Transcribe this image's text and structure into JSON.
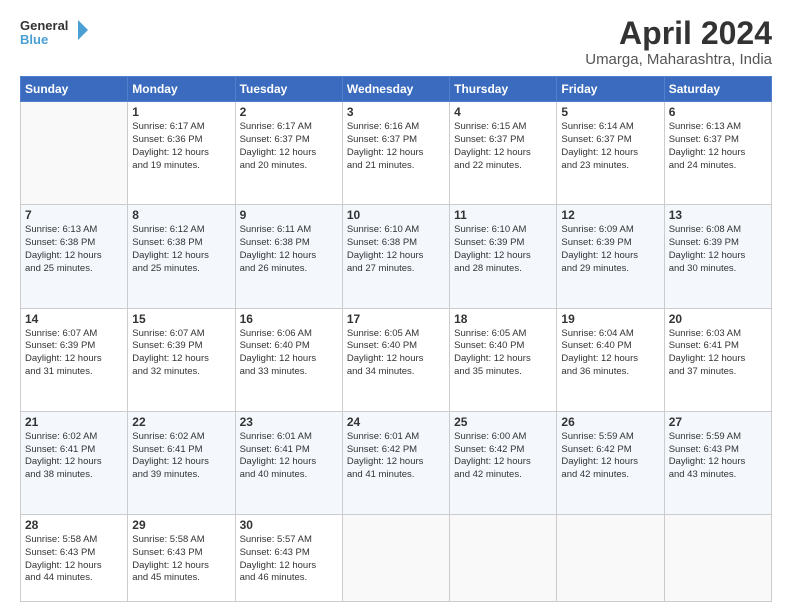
{
  "header": {
    "logo": {
      "line1": "General",
      "line2": "Blue"
    },
    "title": "April 2024",
    "subtitle": "Umarga, Maharashtra, India"
  },
  "weekdays": [
    "Sunday",
    "Monday",
    "Tuesday",
    "Wednesday",
    "Thursday",
    "Friday",
    "Saturday"
  ],
  "weeks": [
    [
      {
        "day": "",
        "info": ""
      },
      {
        "day": "1",
        "info": "Sunrise: 6:17 AM\nSunset: 6:36 PM\nDaylight: 12 hours\nand 19 minutes."
      },
      {
        "day": "2",
        "info": "Sunrise: 6:17 AM\nSunset: 6:37 PM\nDaylight: 12 hours\nand 20 minutes."
      },
      {
        "day": "3",
        "info": "Sunrise: 6:16 AM\nSunset: 6:37 PM\nDaylight: 12 hours\nand 21 minutes."
      },
      {
        "day": "4",
        "info": "Sunrise: 6:15 AM\nSunset: 6:37 PM\nDaylight: 12 hours\nand 22 minutes."
      },
      {
        "day": "5",
        "info": "Sunrise: 6:14 AM\nSunset: 6:37 PM\nDaylight: 12 hours\nand 23 minutes."
      },
      {
        "day": "6",
        "info": "Sunrise: 6:13 AM\nSunset: 6:37 PM\nDaylight: 12 hours\nand 24 minutes."
      }
    ],
    [
      {
        "day": "7",
        "info": "Sunrise: 6:13 AM\nSunset: 6:38 PM\nDaylight: 12 hours\nand 25 minutes."
      },
      {
        "day": "8",
        "info": "Sunrise: 6:12 AM\nSunset: 6:38 PM\nDaylight: 12 hours\nand 25 minutes."
      },
      {
        "day": "9",
        "info": "Sunrise: 6:11 AM\nSunset: 6:38 PM\nDaylight: 12 hours\nand 26 minutes."
      },
      {
        "day": "10",
        "info": "Sunrise: 6:10 AM\nSunset: 6:38 PM\nDaylight: 12 hours\nand 27 minutes."
      },
      {
        "day": "11",
        "info": "Sunrise: 6:10 AM\nSunset: 6:39 PM\nDaylight: 12 hours\nand 28 minutes."
      },
      {
        "day": "12",
        "info": "Sunrise: 6:09 AM\nSunset: 6:39 PM\nDaylight: 12 hours\nand 29 minutes."
      },
      {
        "day": "13",
        "info": "Sunrise: 6:08 AM\nSunset: 6:39 PM\nDaylight: 12 hours\nand 30 minutes."
      }
    ],
    [
      {
        "day": "14",
        "info": "Sunrise: 6:07 AM\nSunset: 6:39 PM\nDaylight: 12 hours\nand 31 minutes."
      },
      {
        "day": "15",
        "info": "Sunrise: 6:07 AM\nSunset: 6:39 PM\nDaylight: 12 hours\nand 32 minutes."
      },
      {
        "day": "16",
        "info": "Sunrise: 6:06 AM\nSunset: 6:40 PM\nDaylight: 12 hours\nand 33 minutes."
      },
      {
        "day": "17",
        "info": "Sunrise: 6:05 AM\nSunset: 6:40 PM\nDaylight: 12 hours\nand 34 minutes."
      },
      {
        "day": "18",
        "info": "Sunrise: 6:05 AM\nSunset: 6:40 PM\nDaylight: 12 hours\nand 35 minutes."
      },
      {
        "day": "19",
        "info": "Sunrise: 6:04 AM\nSunset: 6:40 PM\nDaylight: 12 hours\nand 36 minutes."
      },
      {
        "day": "20",
        "info": "Sunrise: 6:03 AM\nSunset: 6:41 PM\nDaylight: 12 hours\nand 37 minutes."
      }
    ],
    [
      {
        "day": "21",
        "info": "Sunrise: 6:02 AM\nSunset: 6:41 PM\nDaylight: 12 hours\nand 38 minutes."
      },
      {
        "day": "22",
        "info": "Sunrise: 6:02 AM\nSunset: 6:41 PM\nDaylight: 12 hours\nand 39 minutes."
      },
      {
        "day": "23",
        "info": "Sunrise: 6:01 AM\nSunset: 6:41 PM\nDaylight: 12 hours\nand 40 minutes."
      },
      {
        "day": "24",
        "info": "Sunrise: 6:01 AM\nSunset: 6:42 PM\nDaylight: 12 hours\nand 41 minutes."
      },
      {
        "day": "25",
        "info": "Sunrise: 6:00 AM\nSunset: 6:42 PM\nDaylight: 12 hours\nand 42 minutes."
      },
      {
        "day": "26",
        "info": "Sunrise: 5:59 AM\nSunset: 6:42 PM\nDaylight: 12 hours\nand 42 minutes."
      },
      {
        "day": "27",
        "info": "Sunrise: 5:59 AM\nSunset: 6:43 PM\nDaylight: 12 hours\nand 43 minutes."
      }
    ],
    [
      {
        "day": "28",
        "info": "Sunrise: 5:58 AM\nSunset: 6:43 PM\nDaylight: 12 hours\nand 44 minutes."
      },
      {
        "day": "29",
        "info": "Sunrise: 5:58 AM\nSunset: 6:43 PM\nDaylight: 12 hours\nand 45 minutes."
      },
      {
        "day": "30",
        "info": "Sunrise: 5:57 AM\nSunset: 6:43 PM\nDaylight: 12 hours\nand 46 minutes."
      },
      {
        "day": "",
        "info": ""
      },
      {
        "day": "",
        "info": ""
      },
      {
        "day": "",
        "info": ""
      },
      {
        "day": "",
        "info": ""
      }
    ]
  ]
}
